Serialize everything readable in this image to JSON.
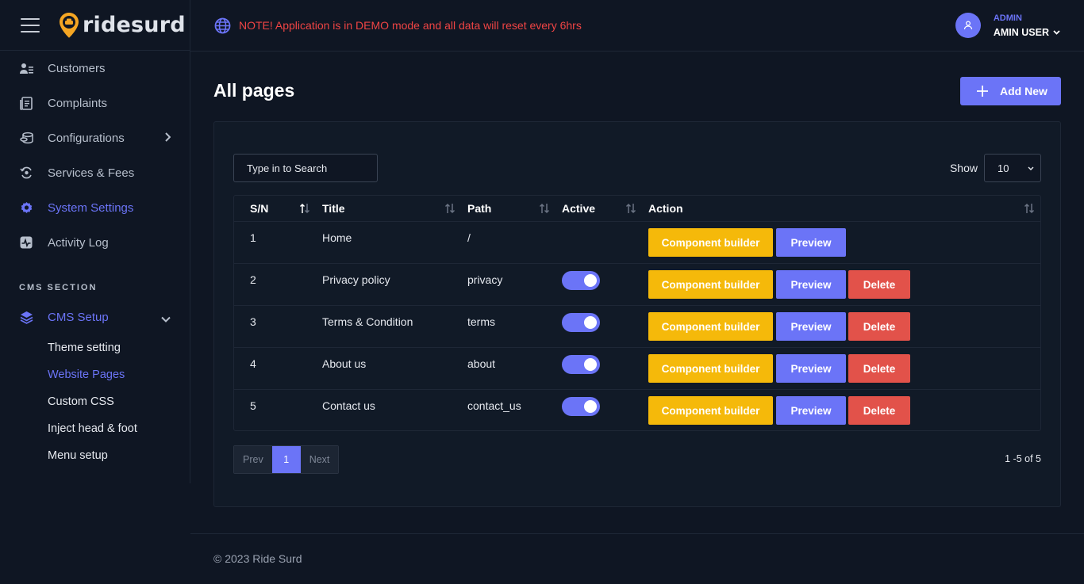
{
  "brand": {
    "name": "ridesurd"
  },
  "notice": "NOTE! Application is in DEMO mode and all data will reset every 6hrs",
  "user": {
    "role": "ADMIN",
    "name": "AMIN USER"
  },
  "sidebar": {
    "items": [
      {
        "label": "Customers",
        "icon": "customers-icon"
      },
      {
        "label": "Complaints",
        "icon": "complaints-icon"
      },
      {
        "label": "Configurations",
        "icon": "configurations-icon",
        "has_submenu": true
      },
      {
        "label": "Services & Fees",
        "icon": "services-icon"
      },
      {
        "label": "System Settings",
        "icon": "gear-icon",
        "active": true
      },
      {
        "label": "Activity Log",
        "icon": "activity-icon"
      }
    ],
    "cms_section_title": "CMS SECTION",
    "cms_setup_label": "CMS Setup",
    "cms_sub_items": [
      {
        "label": "Theme setting"
      },
      {
        "label": "Website Pages",
        "active": true
      },
      {
        "label": "Custom CSS"
      },
      {
        "label": "Inject head & foot"
      },
      {
        "label": "Menu setup"
      }
    ]
  },
  "page": {
    "title": "All pages",
    "add_button": "Add New"
  },
  "search": {
    "placeholder": "Type in to Search"
  },
  "show": {
    "label": "Show",
    "value": "10"
  },
  "table": {
    "headers": {
      "sn": "S/N",
      "title": "Title",
      "path": "Path",
      "active": "Active",
      "action": "Action"
    },
    "rows": [
      {
        "sn": "1",
        "title": "Home",
        "path": "/",
        "active": null
      },
      {
        "sn": "2",
        "title": "Privacy policy",
        "path": "privacy",
        "active": true
      },
      {
        "sn": "3",
        "title": "Terms & Condition",
        "path": "terms",
        "active": true
      },
      {
        "sn": "4",
        "title": "About us",
        "path": "about",
        "active": true
      },
      {
        "sn": "5",
        "title": "Contact us",
        "path": "contact_us",
        "active": true
      }
    ],
    "buttons": {
      "builder": "Component builder",
      "preview": "Preview",
      "delete": "Delete"
    }
  },
  "pagination": {
    "prev": "Prev",
    "current": "1",
    "next": "Next",
    "range": "1 -5 of 5"
  },
  "footer": "© 2023 Ride Surd",
  "colors": {
    "accent": "#6b74f7",
    "warning": "#f5b90a",
    "danger": "#e2524a",
    "notice": "#ef4444",
    "background": "#0f1623"
  }
}
